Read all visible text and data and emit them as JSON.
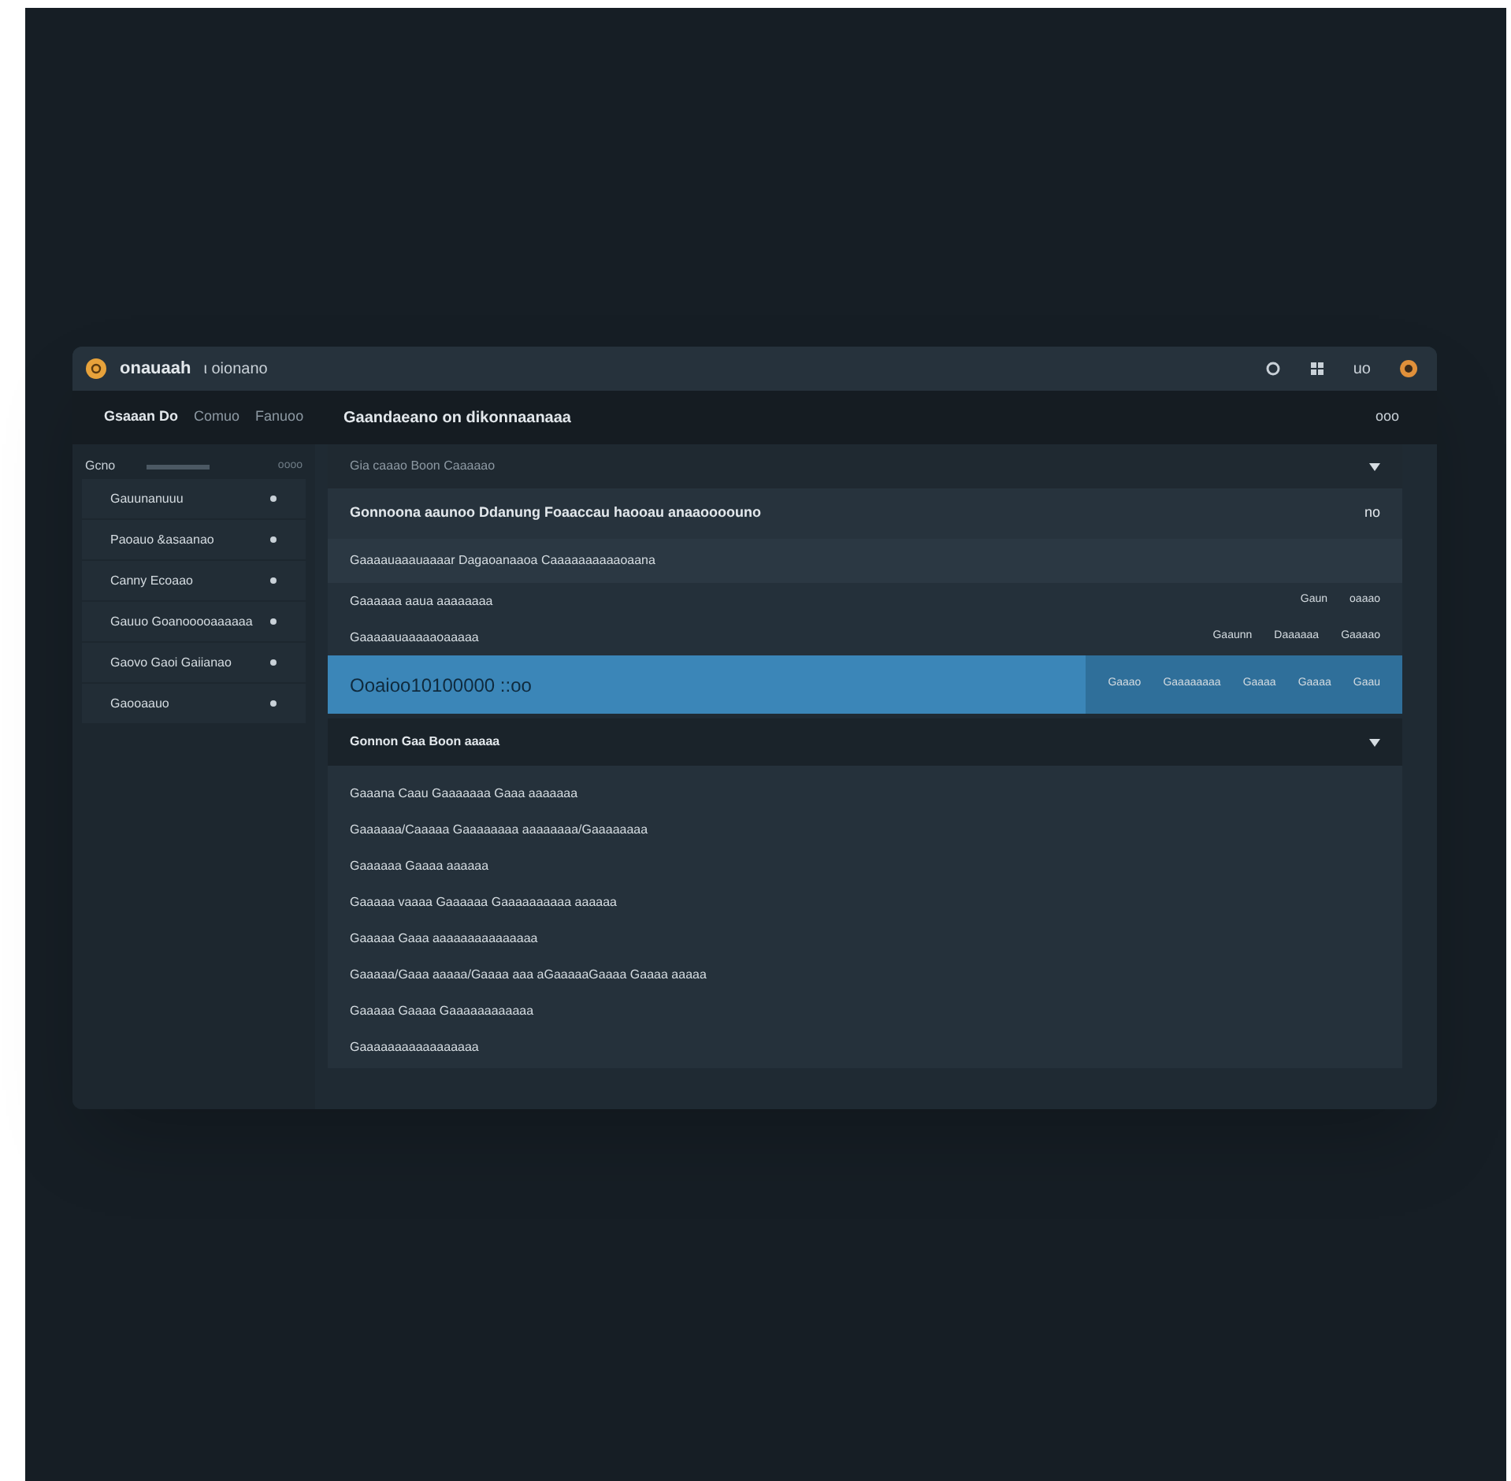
{
  "window": {
    "app_name": "onauaah",
    "subtitle": "ι oionano",
    "controls": [
      {
        "kind": "dot"
      },
      {
        "kind": "grid"
      },
      {
        "kind": "text",
        "label": "uo"
      },
      {
        "kind": "record"
      }
    ]
  },
  "header": {
    "tabs": [
      {
        "label": "Gsaaan Do",
        "selected": true
      },
      {
        "label": "Comuo",
        "selected": false
      },
      {
        "label": "Fanuoo",
        "selected": false
      }
    ],
    "title": "Gaandaeano on dikonnaanaaa",
    "action": "ooo"
  },
  "sidebar": {
    "heading": "Gcno",
    "heading_right": "oooo",
    "items": [
      {
        "label": "Gauunanuuu"
      },
      {
        "label": "Paoauo &asaanao"
      },
      {
        "label": "Canny Ecoaao"
      },
      {
        "label": "Gauuo Goanooooaaaaaa"
      },
      {
        "label": "Gaovo Gaoi Gaiianao"
      },
      {
        "label": "Gaooaauo"
      }
    ]
  },
  "filter": {
    "label": "Gia caaao Boon Caaaaao"
  },
  "rows": [
    {
      "kind": "title",
      "label": "Gonnoona aaunoo  Ddanung Foaaccau haooau anaaoooouno",
      "values": [
        "no"
      ],
      "selected": false
    },
    {
      "kind": "band",
      "label": "Gaaaauaaauaaaar Dagaoanaaoa Caaaaaaaaaaoaana",
      "values": [],
      "selected": false
    },
    {
      "kind": "plain",
      "label": "Gaaaaaa aaua aaaaaaaa",
      "values": [
        "Gaun",
        "oaaao"
      ],
      "selected": false
    },
    {
      "kind": "plain",
      "label": "Gaaaaauaaaaaoaaaaa",
      "values": [
        "Gaaunn",
        "Daaaaaa",
        "Gaaaao"
      ],
      "selected": false
    },
    {
      "kind": "title",
      "label": "Ooaioo10100000 ::oo",
      "values": [
        "Gaaao",
        "Gaaaaaaaa",
        "Gaaaa",
        "Gaaaa",
        "Gaau"
      ],
      "selected": true
    }
  ],
  "section": {
    "title": "Gonnon Gaa Boon aaaaa",
    "expanded": true,
    "items": [
      "Gaaana Caau Gaaaaaaa Gaaa aaaaaaa",
      "Gaaaaaa/Caaaaa Gaaaaaaaa aaaaaaaa/Gaaaaaaaa",
      "Gaaaaaa Gaaaa aaaaaa",
      "Gaaaaa vaaaa Gaaaaaa Gaaaaaaaaaa aaaaaa",
      "Gaaaaa Gaaa aaaaaaaaaaaaaaa",
      "Gaaaaa/Gaaa aaaaa/Gaaaa aaa aGaaaaaGaaaa Gaaaa aaaaa",
      "Gaaaaa Gaaaa Gaaaaaaaaaaaa",
      "Gaaaaaaaaaaaaaaaaa"
    ]
  }
}
